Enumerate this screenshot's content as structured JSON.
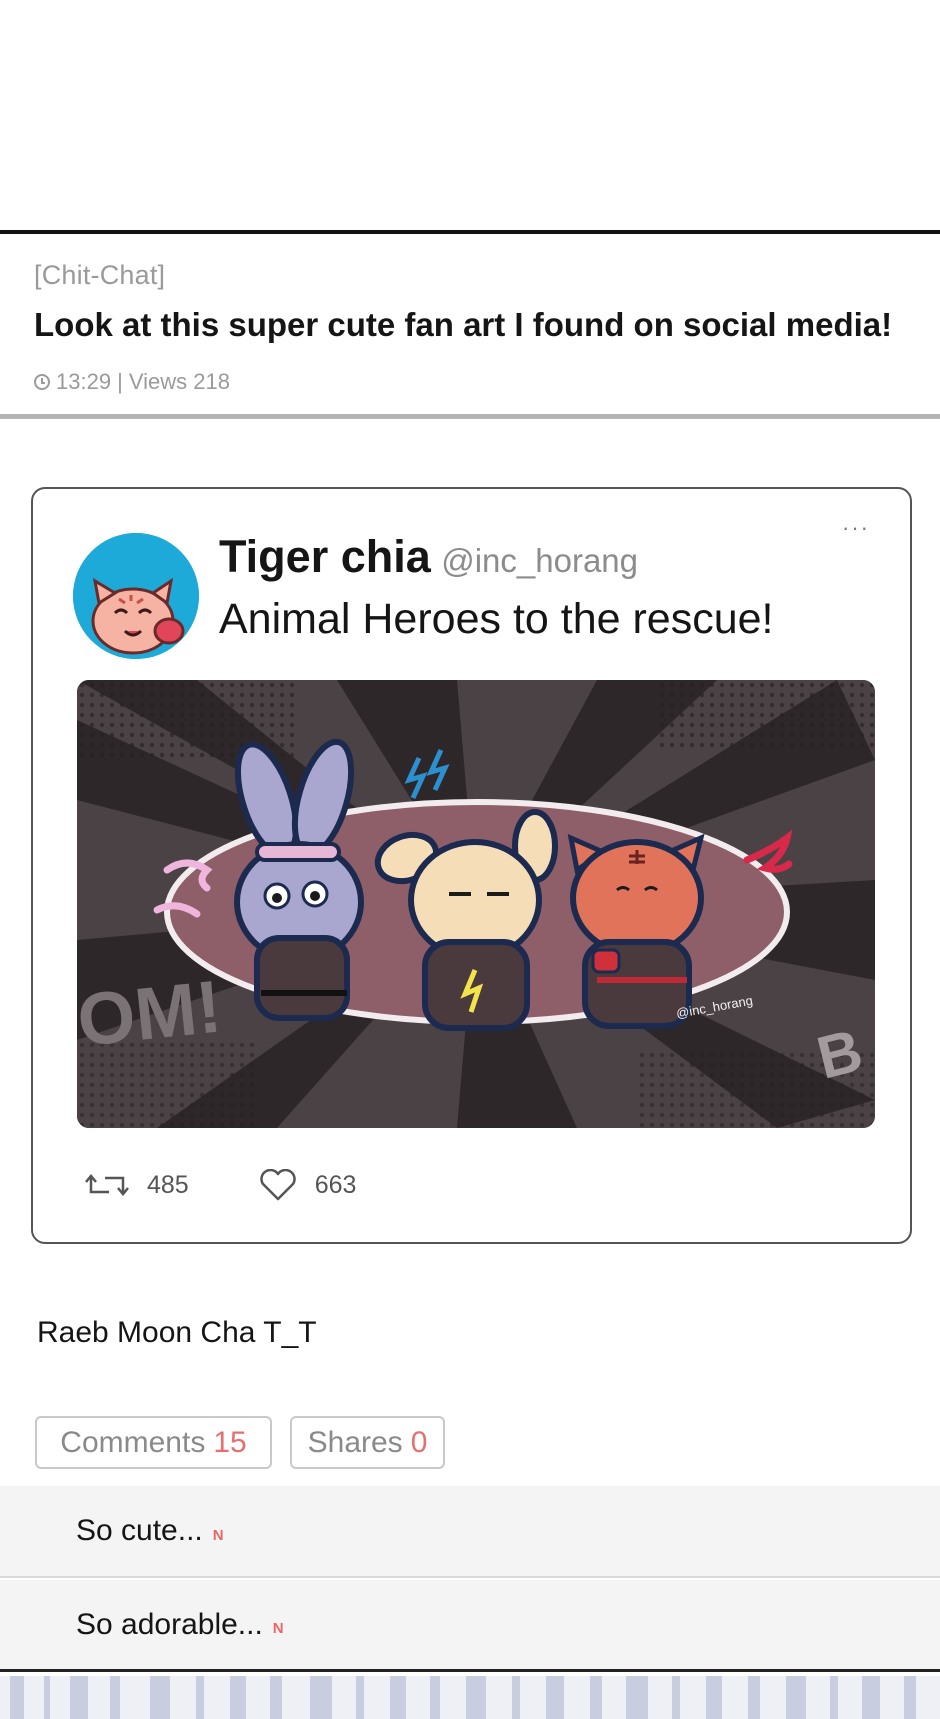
{
  "post": {
    "category": "[Chit-Chat]",
    "title": "Look at this super cute fan art I found on social media!",
    "time": "13:29",
    "views": "| Views 218"
  },
  "tweet": {
    "author_name": "Tiger chia",
    "author_handle": "@inc_horang",
    "text": "Animal Heroes to the rescue!",
    "more_label": "···",
    "image_text": {
      "left_burst": "OM!",
      "right_burst": "B",
      "watermark": "@inc_horang"
    },
    "retweets": "485",
    "likes": "663"
  },
  "subtext": "Raeb Moon Cha T_T",
  "tabs": {
    "comments_label": "Comments",
    "comments_count": "15",
    "shares_label": "Shares",
    "shares_count": "0"
  },
  "comments": [
    {
      "text": "So cute...",
      "badge": "N"
    },
    {
      "text": "So adorable...",
      "badge": "N"
    }
  ],
  "colors": {
    "accent_red": "#e66f6f",
    "avatar_bg": "#1eaad8",
    "divider_dark": "#111111",
    "divider_gray": "#b3b3b3"
  }
}
